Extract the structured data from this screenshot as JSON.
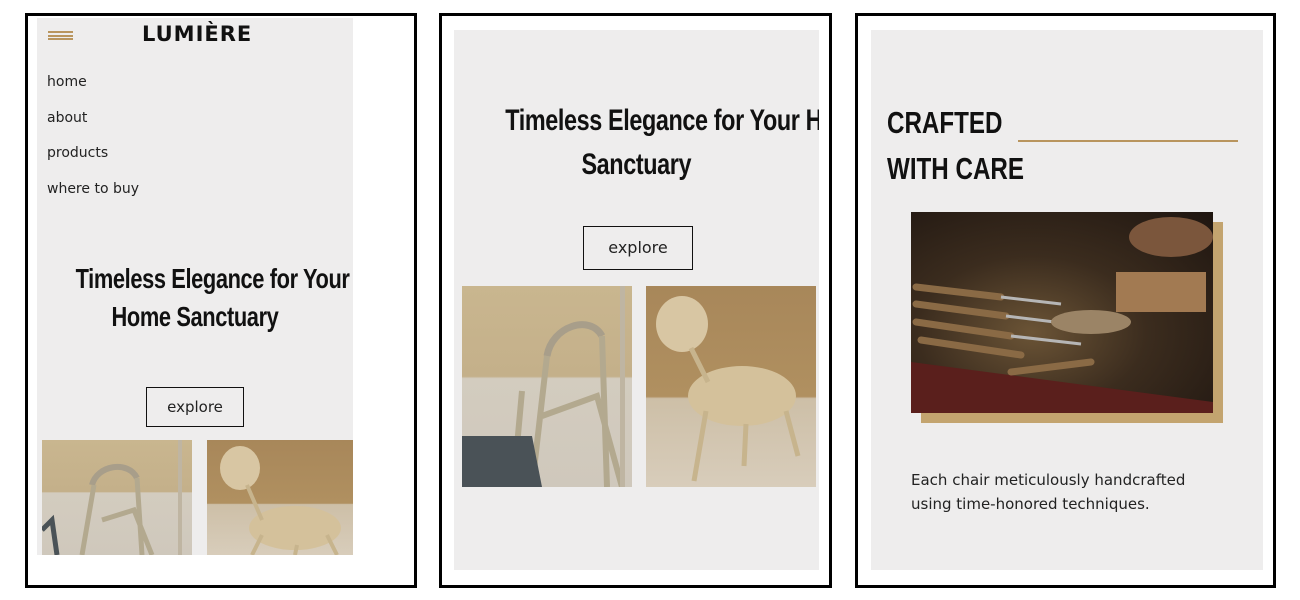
{
  "screen1": {
    "logo": "LUMIÈRE",
    "nav": [
      "home",
      "about",
      "products",
      "where to buy"
    ],
    "hero_title_line1": "Timeless Elegance for Your",
    "hero_title_line2": "Home Sanctuary",
    "explore_label": "explore",
    "menu_icon": "hamburger-menu-icon"
  },
  "screen2": {
    "hero_title_line1": "Timeless Elegance for Your Home",
    "hero_title_line2": "Sanctuary",
    "explore_label": "explore"
  },
  "screen3": {
    "heading_line1": "CRAFTED",
    "heading_line2": "WITH CARE",
    "caption": "Each chair meticulously handcrafted using time-honored techniques."
  },
  "colors": {
    "accent_gold": "#b9955e",
    "background": "#eeeded",
    "frame_border": "#000000"
  }
}
